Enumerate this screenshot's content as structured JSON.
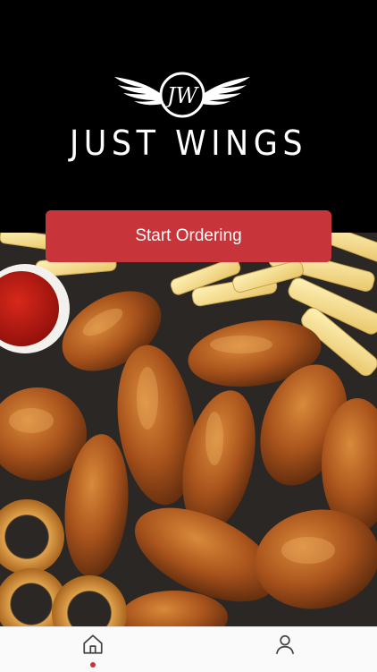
{
  "brand": {
    "monogram": "JW",
    "name": "JUST WINGS"
  },
  "hero": {
    "cta_label": "Start Ordering"
  },
  "tabbar": {
    "items": [
      {
        "id": "home",
        "icon": "home-icon",
        "active": true
      },
      {
        "id": "account",
        "icon": "user-icon",
        "active": false
      }
    ]
  },
  "colors": {
    "background": "#000000",
    "accent": "#c7353a",
    "tabbar": "#fafafa"
  }
}
